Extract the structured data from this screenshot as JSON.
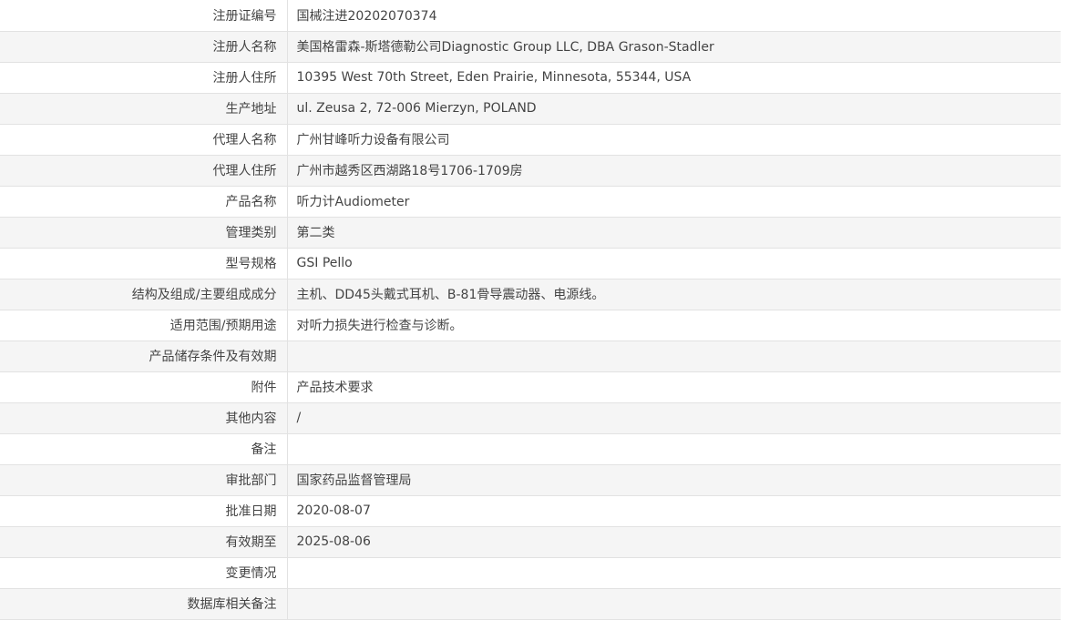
{
  "records": [
    {
      "label": "注册证编号",
      "value": "国械注进20202070374"
    },
    {
      "label": "注册人名称",
      "value": "美国格雷森-斯塔德勒公司Diagnostic Group LLC, DBA Grason-Stadler"
    },
    {
      "label": "注册人住所",
      "value": "10395 West 70th Street, Eden Prairie, Minnesota, 55344, USA"
    },
    {
      "label": "生产地址",
      "value": "ul. Zeusa 2, 72-006 Mierzyn, POLAND"
    },
    {
      "label": "代理人名称",
      "value": "广州甘峰听力设备有限公司"
    },
    {
      "label": "代理人住所",
      "value": "广州市越秀区西湖路18号1706-1709房"
    },
    {
      "label": "产品名称",
      "value": "听力计Audiometer"
    },
    {
      "label": "管理类别",
      "value": "第二类"
    },
    {
      "label": "型号规格",
      "value": "GSI Pello"
    },
    {
      "label": "结构及组成/主要组成成分",
      "value": "主机、DD45头戴式耳机、B-81骨导震动器、电源线。"
    },
    {
      "label": "适用范围/预期用途",
      "value": "对听力损失进行检查与诊断。"
    },
    {
      "label": "产品储存条件及有效期",
      "value": ""
    },
    {
      "label": "附件",
      "value": "产品技术要求"
    },
    {
      "label": "其他内容",
      "value": "/"
    },
    {
      "label": "备注",
      "value": ""
    },
    {
      "label": "审批部门",
      "value": "国家药品监督管理局"
    },
    {
      "label": "批准日期",
      "value": "2020-08-07"
    },
    {
      "label": "有效期至",
      "value": "2025-08-06"
    },
    {
      "label": "变更情况",
      "value": ""
    },
    {
      "label": "数据库相关备注",
      "value": ""
    }
  ]
}
